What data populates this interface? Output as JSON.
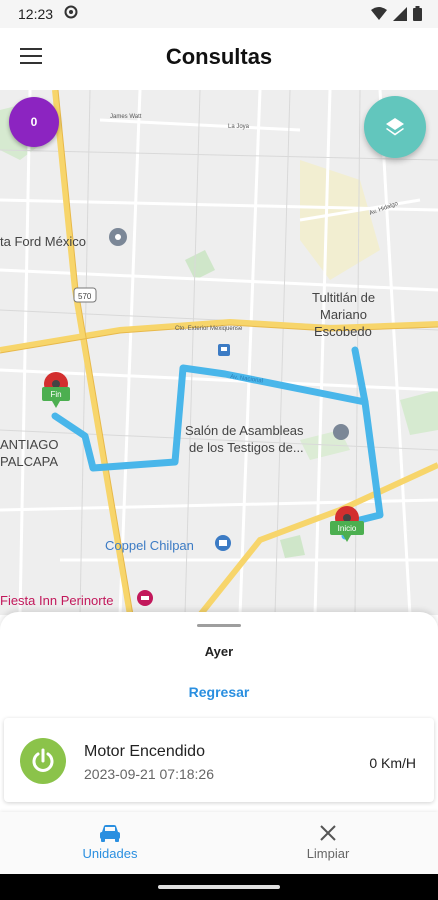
{
  "status": {
    "time": "12:23",
    "icons": [
      "settings-icon",
      "wifi-icon",
      "signal-icon",
      "battery-icon"
    ]
  },
  "appbar": {
    "title": "Consultas"
  },
  "map": {
    "badge_count": "0",
    "places": {
      "james_watt": "James Watt",
      "la_joya": "La Joya",
      "ford": "ta Ford México",
      "route_570": "570",
      "av_hidalgo": "Av. Hidalgo",
      "tultitlan_1": "Tultitlán de",
      "tultitlan_2": "Mariano",
      "tultitlan_3": "Escobedo",
      "circuito": "Cto. Exterior Mexiquense",
      "santiago_1": "ANTIAGO",
      "santiago_2": "PALCAPA",
      "salon_1": "Salón de Asambleas",
      "salon_2": "de los Testigos de...",
      "coppel": "Coppel Chilpan",
      "fiesta": "Fiesta Inn Perinorte",
      "av_nacional": "Av. Nacional"
    },
    "markers": {
      "end": "Fin",
      "start": "Inicio"
    },
    "route_color": "#49b6ea"
  },
  "sheet": {
    "day": "Ayer",
    "back_label": "Regresar",
    "events": [
      {
        "name": "Motor Encendido",
        "timestamp": "2023-09-21 07:18:26",
        "speed": "0 Km/H"
      }
    ]
  },
  "nav": {
    "units_label": "Unidades",
    "clear_label": "Limpiar"
  },
  "colors": {
    "accent": "#2a8fe0",
    "badge": "#8c24c1",
    "fab": "#62c6bd",
    "engine_on": "#8bc34a",
    "marker_red": "#d32f2f",
    "marker_green": "#4caf50"
  }
}
